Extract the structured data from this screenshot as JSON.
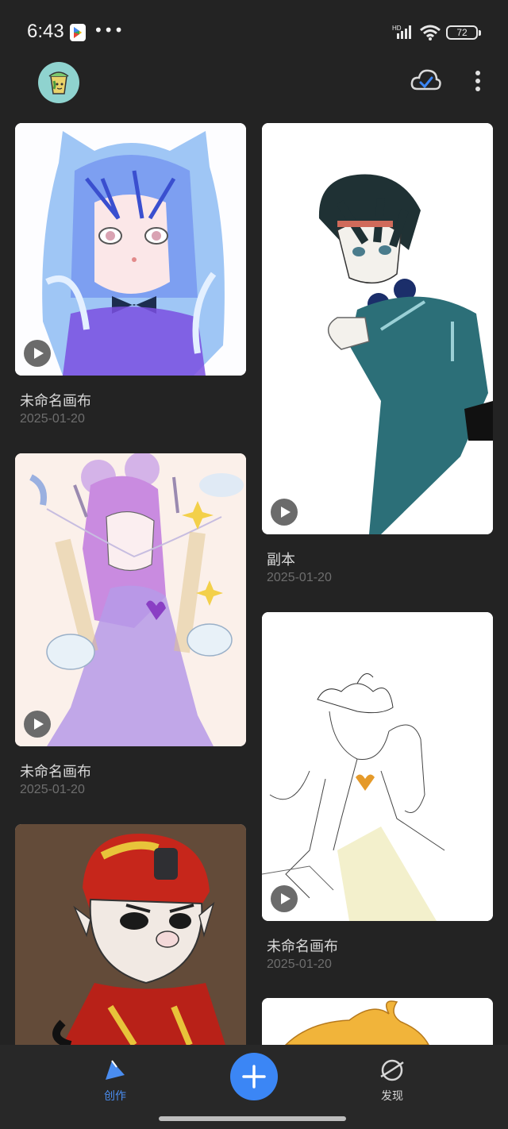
{
  "status_bar": {
    "time": "6:43",
    "more": "•••",
    "network": "HD",
    "battery": "72"
  },
  "header": {
    "avatar_icon": "paint-bucket-avatar",
    "cloud_icon": "cloud-sync-check-icon",
    "more_icon": "more-vertical-icon"
  },
  "cards": [
    {
      "title": "未命名画布",
      "date": "2025-01-20"
    },
    {
      "title": "副本",
      "date": "2025-01-20"
    },
    {
      "title": "未命名画布",
      "date": "2025-01-20"
    },
    {
      "title": "未命名画布",
      "date": "2025-01-20"
    },
    {
      "title": "",
      "date": ""
    },
    {
      "title": "",
      "date": ""
    }
  ],
  "bottom_nav": {
    "create_label": "创作",
    "discover_label": "发现",
    "add_icon": "plus-icon"
  },
  "colors": {
    "accent": "#3b86f5",
    "background": "#232323",
    "nav_active": "#4a8df0"
  }
}
